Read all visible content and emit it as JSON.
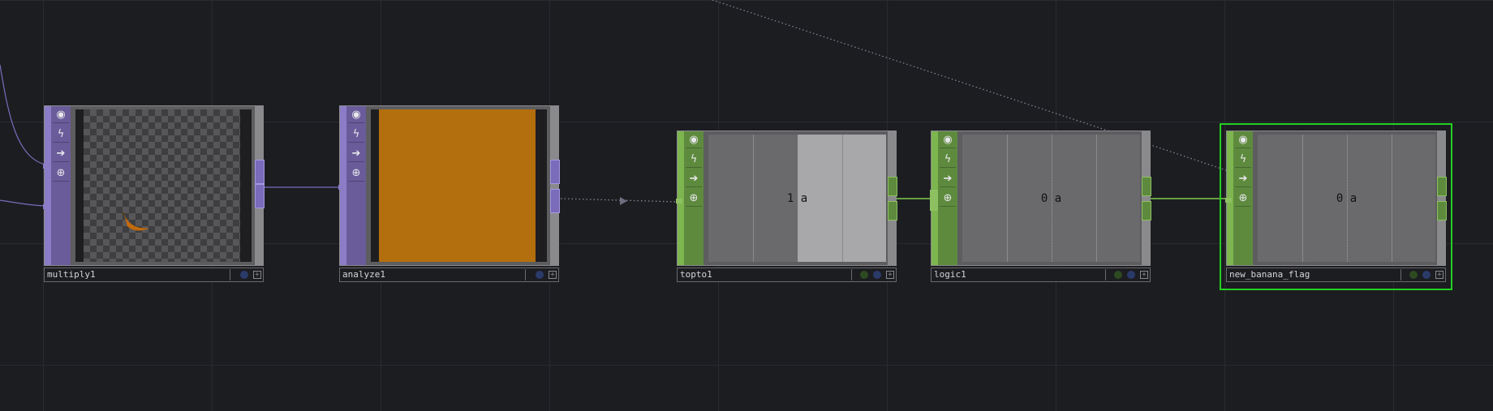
{
  "colors": {
    "background": "#1c1d21",
    "top_family": "#6a5b9a",
    "chop_family": "#5e8a3e",
    "selection": "#22d022",
    "wire_top": "#7b6bbb",
    "wire_chop": "#7ccf4a",
    "analyze_color": "#b36e0e"
  },
  "nodes": {
    "multiply1": {
      "name": "multiply1",
      "family": "TOP",
      "preview": "banana-over-transparent"
    },
    "analyze1": {
      "name": "analyze1",
      "family": "TOP",
      "preview": "solid-orange"
    },
    "topto1": {
      "name": "topto1",
      "family": "CHOP",
      "value": "1",
      "channel": "a"
    },
    "logic1": {
      "name": "logic1",
      "family": "CHOP",
      "value": "0",
      "channel": "a"
    },
    "new_banana_flag": {
      "name": "new_banana_flag",
      "family": "CHOP",
      "value": "0",
      "channel": "a",
      "selected": true
    }
  },
  "sidebar_icons": [
    "viewer-toggle-icon",
    "cook-lightning-icon",
    "export-arrow-icon",
    "lock-icon"
  ],
  "flag_icons": [
    "bypass-flag-icon",
    "display-flag-icon",
    "render-flag-icon"
  ]
}
